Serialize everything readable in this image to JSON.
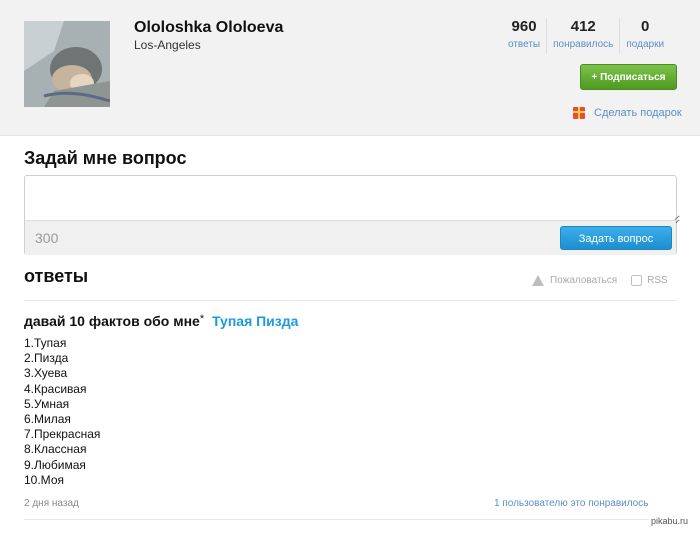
{
  "profile": {
    "name": "Ololoshka Ololoeva",
    "city": "Los-Angeles",
    "stats": [
      {
        "value": "960",
        "label": "ответы"
      },
      {
        "value": "412",
        "label": "понравилось"
      },
      {
        "value": "0",
        "label": "подарки"
      }
    ],
    "subscribe_label": "+ Подписаться",
    "gift_label": "Сделать подарок"
  },
  "ask": {
    "title": "Задай мне вопрос",
    "input_placeholder": "",
    "char_counter": "300",
    "submit_label": "Задать вопрос"
  },
  "answers": {
    "title": "ответы",
    "report_label": "Пожаловаться",
    "rss_label": "RSS",
    "items": [
      {
        "question": "давай 10 фактов обо мне",
        "star": "*",
        "author": "Тупая Пизда",
        "lines": [
          "1.Тупая",
          "2.Пизда",
          "3.Хуева",
          "4.Красивая",
          "5.Умная",
          "6.Милая",
          "7.Прекрасная",
          "8.Классная",
          "9.Любимая",
          "10.Моя"
        ],
        "time": "2 дня назад",
        "likes": "1 пользователю это понравилось"
      }
    ]
  },
  "watermark": "pikabu.ru",
  "colors": {
    "accent_blue": "#1a9bdb",
    "link_blue": "#5a8fc4",
    "subscribe_green": "#5aa82b",
    "header_bg": "#f2f2f2"
  }
}
